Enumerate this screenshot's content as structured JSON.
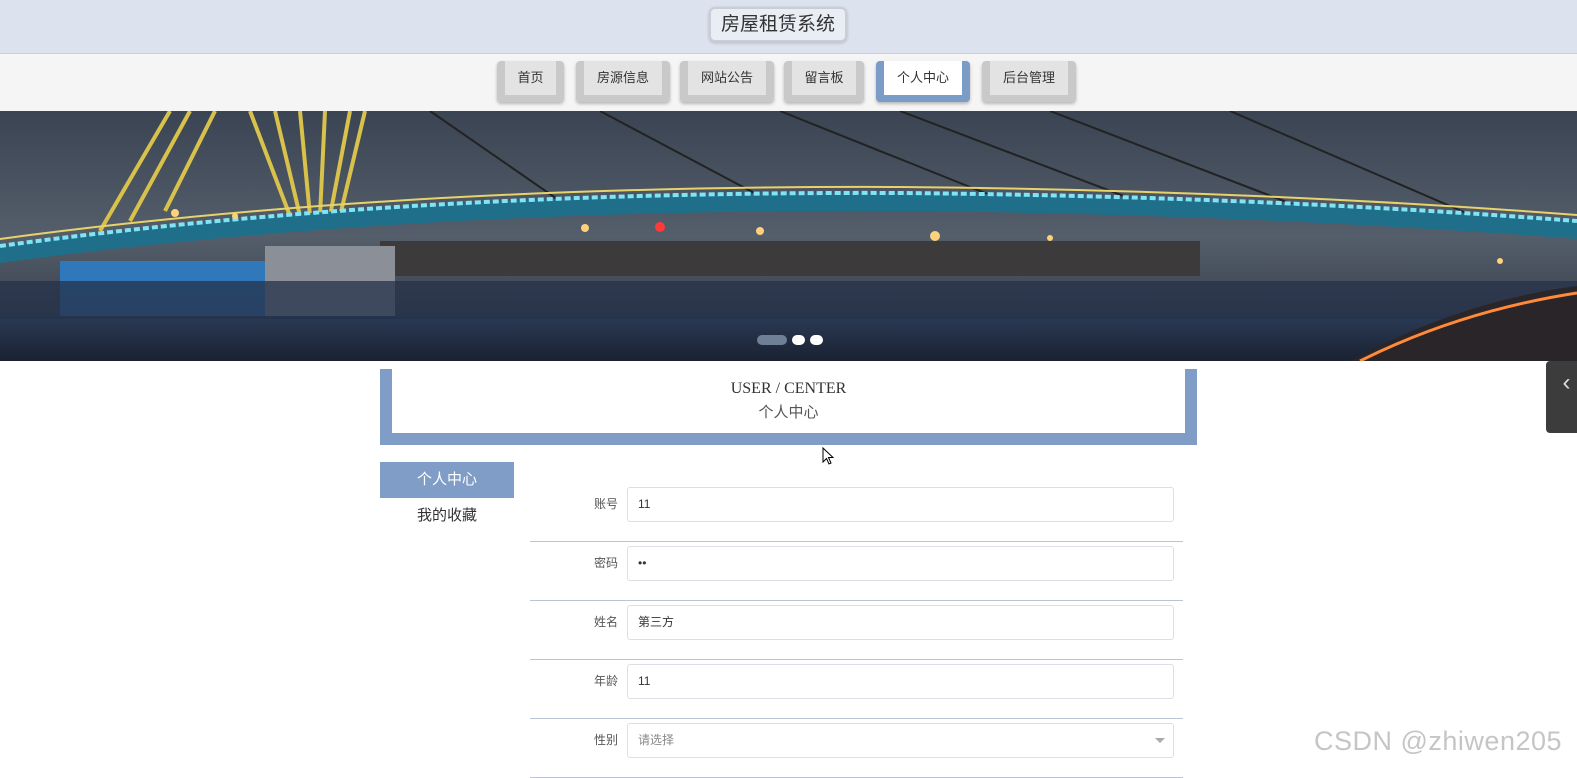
{
  "header": {
    "site_title": "房屋租赁系统"
  },
  "nav": {
    "items": [
      {
        "label": "首页"
      },
      {
        "label": "房源信息"
      },
      {
        "label": "网站公告"
      },
      {
        "label": "留言板"
      },
      {
        "label": "个人中心",
        "active": true
      },
      {
        "label": "后台管理"
      }
    ]
  },
  "banner": {
    "image": "night-bridge-river-photo",
    "slides": 3,
    "active_slide": 1
  },
  "section": {
    "title_en": "USER / CENTER",
    "title_cn": "个人中心"
  },
  "side_menu": {
    "items": [
      {
        "label": "个人中心",
        "active": true
      },
      {
        "label": "我的收藏"
      }
    ]
  },
  "form": {
    "fields": [
      {
        "label": "账号",
        "value": "11"
      },
      {
        "label": "密码",
        "value": "••"
      },
      {
        "label": "姓名",
        "value": "第三方"
      },
      {
        "label": "年龄",
        "value": "11"
      },
      {
        "label": "性别",
        "placeholder": "请选择",
        "type": "select"
      }
    ]
  },
  "watermark": "CSDN @zhiwen205",
  "colors": {
    "accent": "#7f9dc6",
    "title_bar": "#dde3ee",
    "nav_button": "#c9c9c9"
  }
}
